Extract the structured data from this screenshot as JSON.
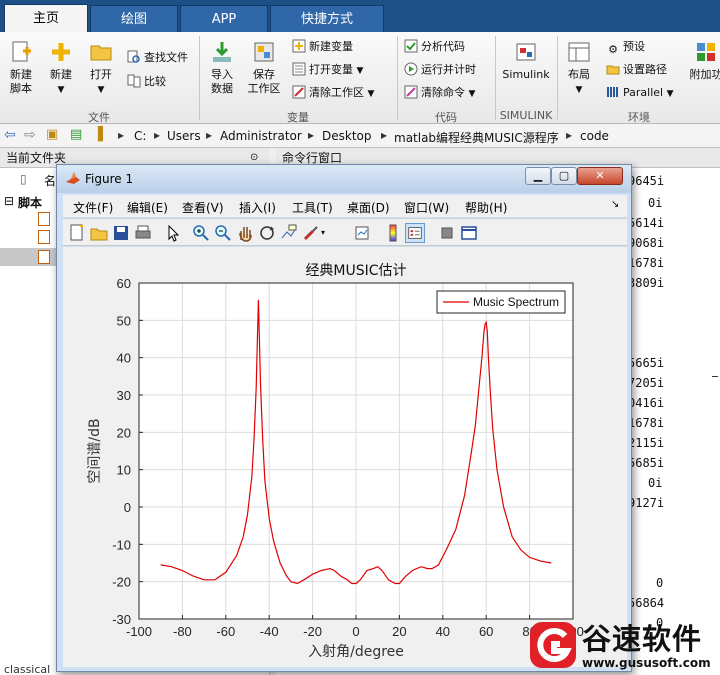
{
  "tabs": [
    "主页",
    "绘图",
    "APP",
    "快捷方式"
  ],
  "ribbon": {
    "new_script": "新建\n脚本",
    "new": "新建",
    "open": "打开",
    "find_files": "查找文件",
    "compare": "比较",
    "import": "导入\n数据",
    "save_ws": "保存\n工作区",
    "new_var": "新建变量",
    "open_var": "打开变量",
    "clear_ws": "清除工作区",
    "analyze": "分析代码",
    "run_time": "运行并计时",
    "clear_cmd": "清除命令",
    "simulink": "Simulink",
    "layout": "布局",
    "prefs": "预设",
    "set_path": "设置路径",
    "parallel": "Parallel",
    "addons": "附加功",
    "groups": [
      "文件",
      "变量",
      "代码",
      "SIMULINK",
      "环境"
    ]
  },
  "address": [
    "C:",
    "Users",
    "Administrator",
    "Desktop",
    "matlab编程经典MUSIC源程序",
    "code"
  ],
  "panels": {
    "current_folder": "当前文件夹",
    "name_col": "名",
    "scripts": "脚本",
    "command_window": "命令行窗口",
    "bottom_status": "classical"
  },
  "cmd_lines": [
    "9645i",
    "0i",
    "5614i",
    "9068i",
    "1678i",
    "3809i",
    "5665i",
    "7205i",
    "0416i",
    "1678i",
    "2115i",
    "5685i",
    "0i",
    "9127i",
    "0",
    "56864",
    "0"
  ],
  "figure": {
    "title": "Figure 1",
    "menu": [
      "文件(F)",
      "编辑(E)",
      "查看(V)",
      "插入(I)",
      "工具(T)",
      "桌面(D)",
      "窗口(W)",
      "帮助(H)"
    ]
  },
  "watermark": {
    "brand": "谷速软件",
    "url": "www.gususoft.com"
  },
  "colors": {
    "line": "#e00000",
    "tabbar": "#1e4f86"
  },
  "chart_data": {
    "type": "line",
    "title": "经典MUSIC估计",
    "xlabel": "入射角/degree",
    "ylabel": "空间谱/dB",
    "xlim": [
      -100,
      100
    ],
    "ylim": [
      -30,
      60
    ],
    "xticks": [
      -100,
      -80,
      -60,
      -40,
      -20,
      0,
      20,
      40,
      60,
      80,
      100
    ],
    "yticks": [
      -30,
      -20,
      -10,
      0,
      10,
      20,
      30,
      40,
      50,
      60
    ],
    "grid": true,
    "legend_position": "top-right",
    "series": [
      {
        "name": "Music Spectrum",
        "x": [
          -90,
          -85,
          -80,
          -75,
          -70,
          -65,
          -60,
          -55,
          -52,
          -50,
          -48,
          -47,
          -46,
          -45.5,
          -45,
          -44.5,
          -44,
          -43,
          -42,
          -40,
          -38,
          -35,
          -32,
          -30,
          -27,
          -24,
          -20,
          -16,
          -12,
          -10,
          -7,
          -4,
          -2,
          0,
          2,
          5,
          8,
          10,
          12,
          15,
          18,
          20,
          23,
          26,
          30,
          33,
          35,
          38,
          42,
          46,
          50,
          53,
          55,
          57,
          58,
          59,
          59.5,
          60,
          60.5,
          61,
          62,
          63,
          65,
          68,
          72,
          76,
          80,
          85,
          90
        ],
        "y": [
          -15.5,
          -16,
          -17,
          -18.5,
          -19.5,
          -19.5,
          -17.5,
          -13,
          -8,
          -2,
          8,
          18,
          32,
          44,
          55.5,
          45,
          33,
          18,
          7,
          -3,
          -9,
          -15,
          -18.5,
          -20,
          -20.5,
          -19.5,
          -18,
          -17,
          -16.5,
          -17,
          -18.5,
          -19.5,
          -20.5,
          -20.5,
          -19.5,
          -17,
          -16.5,
          -16,
          -17,
          -19.5,
          -20.5,
          -20.5,
          -18.5,
          -17,
          -16,
          -16.5,
          -16.5,
          -15.5,
          -11,
          -6,
          3,
          14,
          22,
          34,
          40,
          47,
          49,
          49.5,
          47,
          40,
          30,
          21,
          10,
          0,
          -8,
          -11.5,
          -13.5,
          -14.5,
          -15
        ]
      }
    ]
  }
}
